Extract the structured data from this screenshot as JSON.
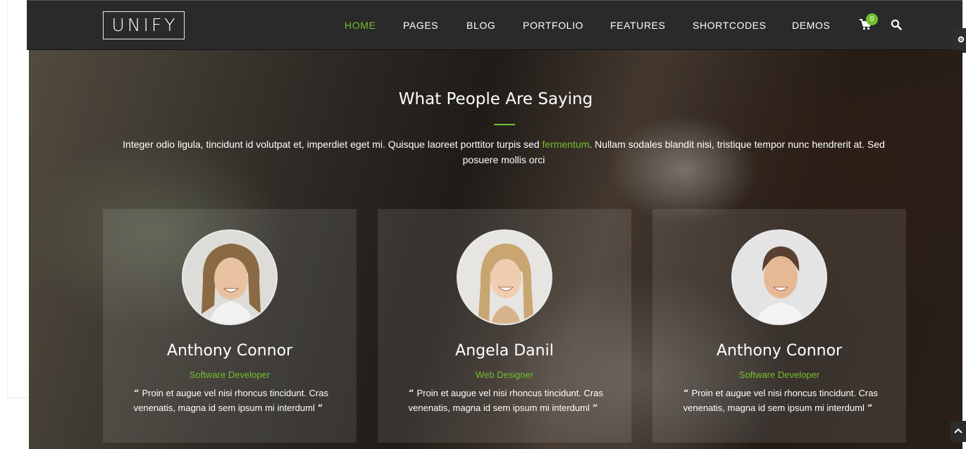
{
  "header": {
    "logo": "UNIFY",
    "nav": [
      {
        "label": "HOME",
        "active": true
      },
      {
        "label": "PAGES"
      },
      {
        "label": "BLOG"
      },
      {
        "label": "PORTFOLIO"
      },
      {
        "label": "FEATURES"
      },
      {
        "label": "SHORTCODES"
      },
      {
        "label": "DEMOS"
      }
    ],
    "cart_count": "0",
    "cart_icon": "shopping-cart-icon",
    "search_icon": "search-icon"
  },
  "section": {
    "title": "What People Are Saying",
    "description_before": "Integer odio ligula, tincidunt id volutpat et, imperdiet eget mi. Quisque laoreet porttitor turpis sed ",
    "description_link": "fermentum",
    "description_after": ". Nullam sodales blandit nisi, tristique tempor nunc hendrerit at. Sed posuere mollis orci"
  },
  "testimonials": [
    {
      "name": "Anthony Connor",
      "role": "Software Developer",
      "quote": "Proin et augue vel nisi rhoncus tincidunt. Cras venenatis, magna id sem ipsum mi interduml"
    },
    {
      "name": "Angela Danil",
      "role": "Web Designer",
      "quote": "Proin et augue vel nisi rhoncus tincidunt. Cras venenatis, magna id sem ipsum mi interduml"
    },
    {
      "name": "Anthony Connor",
      "role": "Software Developer",
      "quote": "Proin et augue vel nisi rhoncus tincidunt. Cras venenatis, magna id sem ipsum mi interduml"
    }
  ],
  "quote_open": "“",
  "quote_close": "”",
  "colors": {
    "accent": "#72c02c",
    "navbar": "#2a2a2a"
  }
}
